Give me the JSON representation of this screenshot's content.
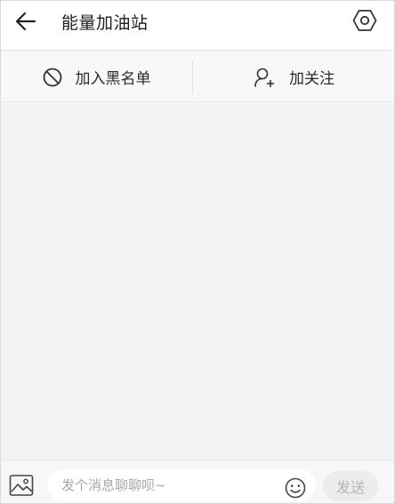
{
  "header": {
    "title": "能量加油站",
    "back_icon": "arrow-left-icon",
    "settings_icon": "hexagon-settings-icon"
  },
  "actions": {
    "blacklist_label": "加入黑名单",
    "blacklist_icon": "block-icon",
    "follow_label": "加关注",
    "follow_icon": "add-user-icon"
  },
  "composer": {
    "placeholder": "发个消息聊聊呗~",
    "value": "",
    "send_label": "发送",
    "image_icon": "image-icon",
    "emoji_icon": "emoji-icon"
  },
  "colors": {
    "background": "#f1f2f4",
    "header": "#ffffff",
    "text": "#1f1f1f",
    "send_disabled_text": "#b5b5b8"
  }
}
